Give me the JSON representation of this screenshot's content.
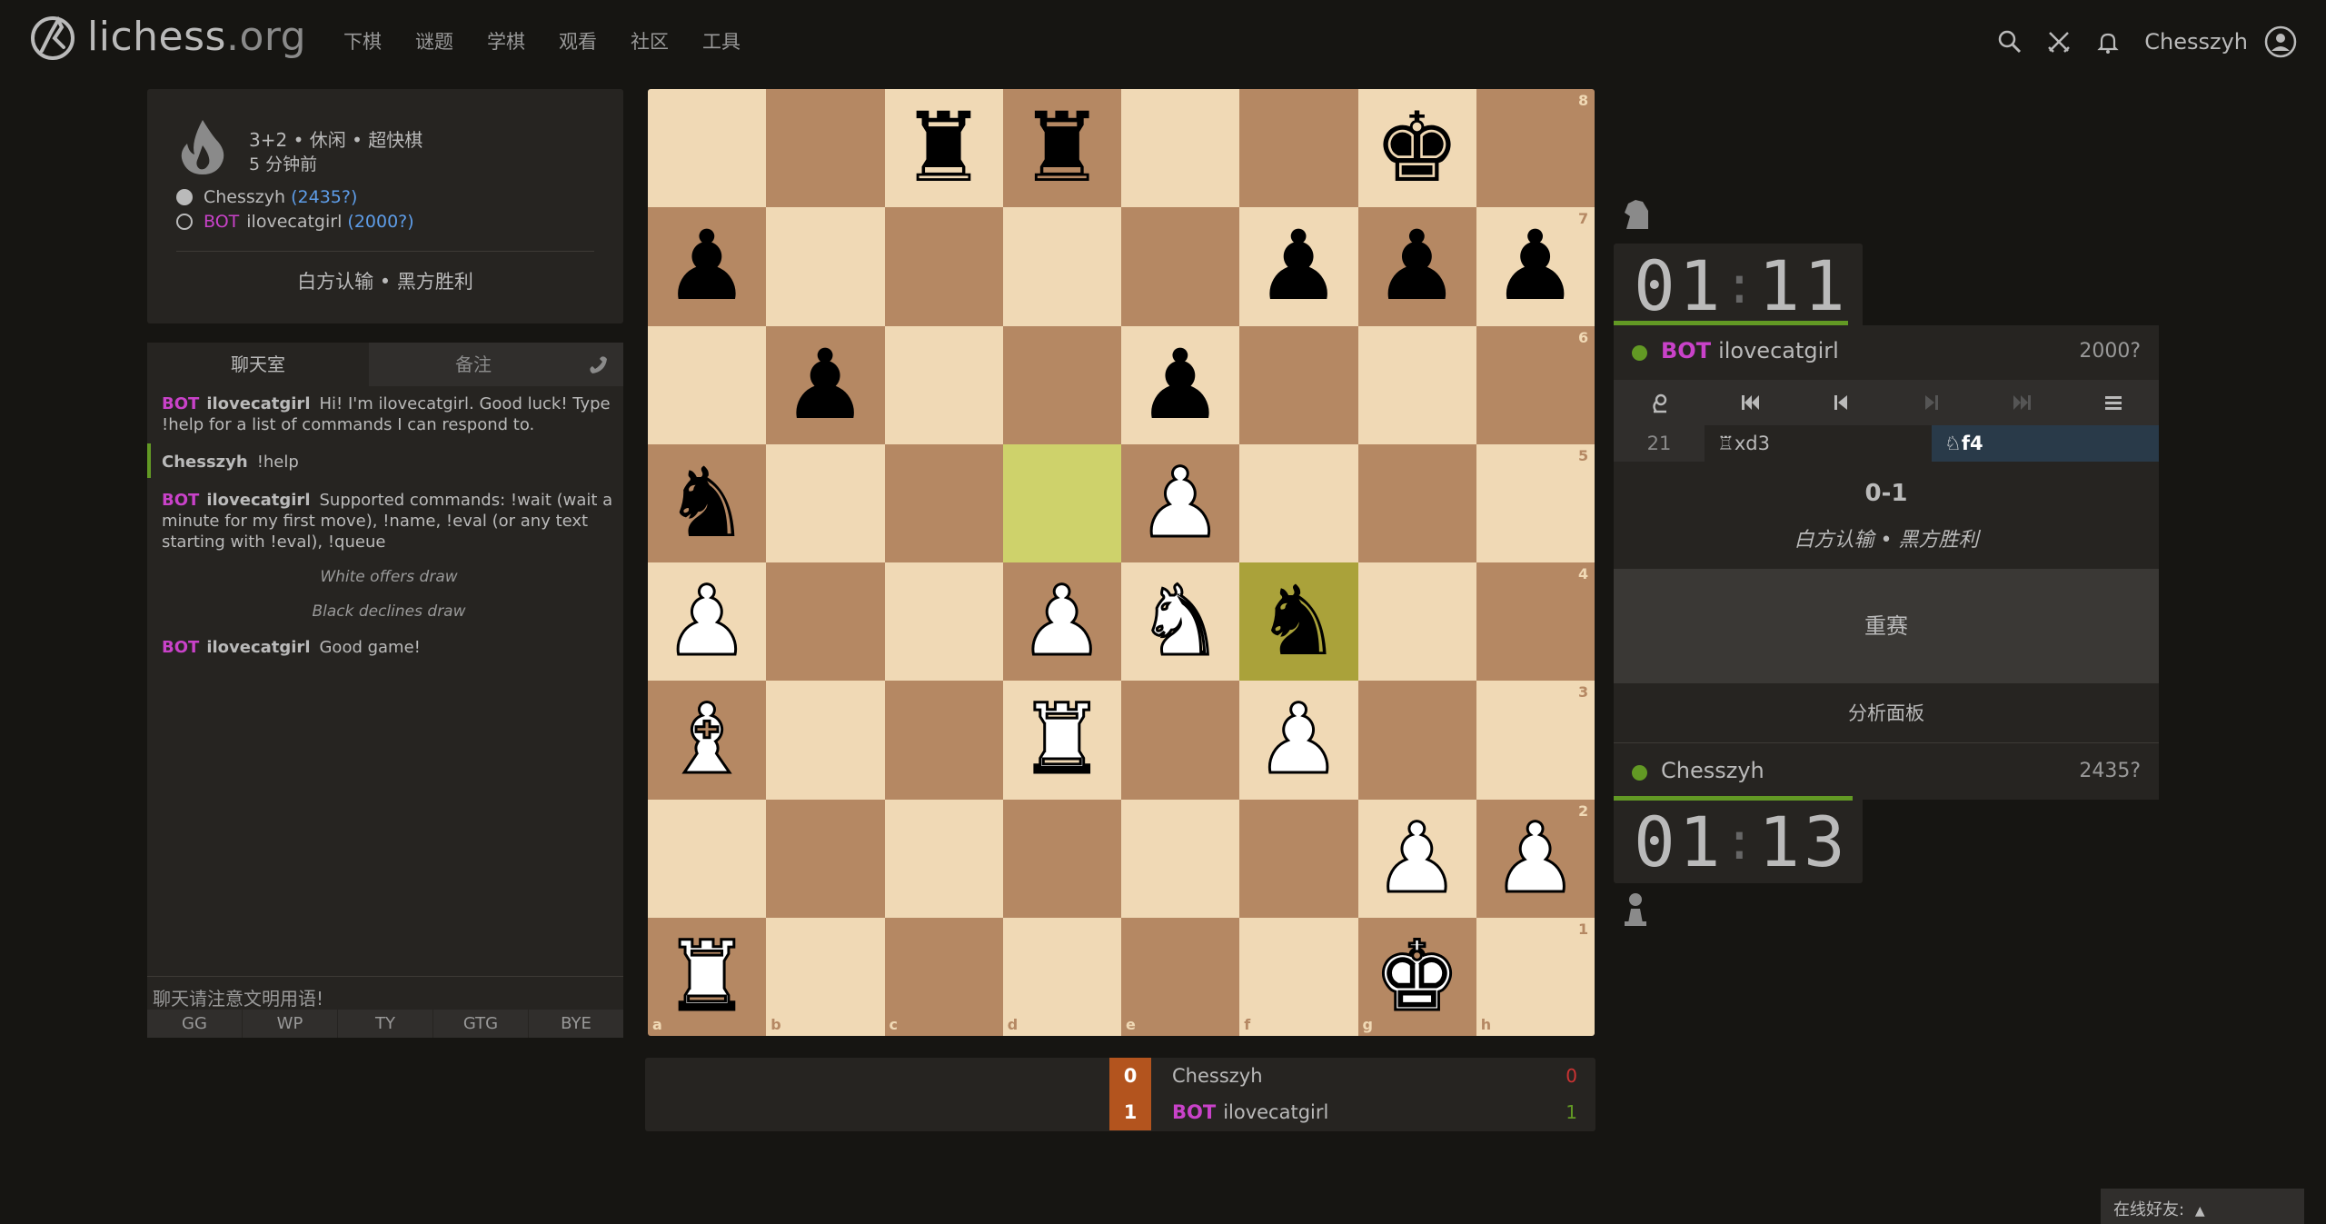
{
  "header": {
    "logo_main": "lichess",
    "logo_tld": ".org",
    "nav": [
      "下棋",
      "谜题",
      "学棋",
      "观看",
      "社区",
      "工具"
    ],
    "username": "Chesszyh"
  },
  "game_info": {
    "mode": "3+2 • 休闲 • 超快棋",
    "time_ago": "5 分钟前",
    "white_name": "Chesszyh",
    "white_rating": "(2435?)",
    "black_bot_tag": "BOT",
    "black_name": "ilovecatgirl",
    "black_rating": "(2000?)",
    "result_text": "白方认输 • 黑方胜利"
  },
  "chat": {
    "tab_chat": "聊天室",
    "tab_notes": "备注",
    "messages": [
      {
        "bot": "BOT",
        "author": "ilovecatgirl",
        "text": "Hi! I'm ilovecatgirl. Good luck! Type !help for a list of commands I can respond to."
      },
      {
        "bot": "",
        "author": "Chesszyh",
        "text": "!help"
      },
      {
        "bot": "BOT",
        "author": "ilovecatgirl",
        "text": "Supported commands: !wait (wait a minute for my first move), !name, !eval (or any text starting with !eval), !queue"
      },
      {
        "system": "White offers draw"
      },
      {
        "system": "Black declines draw"
      },
      {
        "bot": "BOT",
        "author": "ilovecatgirl",
        "text": "Good game!"
      }
    ],
    "input_placeholder": "聊天请注意文明用语!",
    "presets": [
      "GG",
      "WP",
      "TY",
      "GTG",
      "BYE"
    ]
  },
  "board": {
    "files": [
      "a",
      "b",
      "c",
      "d",
      "e",
      "f",
      "g",
      "h"
    ],
    "ranks": [
      "8",
      "7",
      "6",
      "5",
      "4",
      "3",
      "2",
      "1"
    ],
    "last_move_squares": [
      "d5",
      "f4"
    ],
    "pieces": [
      {
        "sq": "c8",
        "g": "♜",
        "c": "b"
      },
      {
        "sq": "d8",
        "g": "♜",
        "c": "b"
      },
      {
        "sq": "g8",
        "g": "♚",
        "c": "b"
      },
      {
        "sq": "a7",
        "g": "♟",
        "c": "b"
      },
      {
        "sq": "f7",
        "g": "♟",
        "c": "b"
      },
      {
        "sq": "g7",
        "g": "♟",
        "c": "b"
      },
      {
        "sq": "h7",
        "g": "♟",
        "c": "b"
      },
      {
        "sq": "b6",
        "g": "♟",
        "c": "b"
      },
      {
        "sq": "e6",
        "g": "♟",
        "c": "b"
      },
      {
        "sq": "a5",
        "g": "♞",
        "c": "b"
      },
      {
        "sq": "e5",
        "g": "♟",
        "c": "w"
      },
      {
        "sq": "a4",
        "g": "♟",
        "c": "w"
      },
      {
        "sq": "d4",
        "g": "♟",
        "c": "w"
      },
      {
        "sq": "e4",
        "g": "♞",
        "c": "w"
      },
      {
        "sq": "f4",
        "g": "♞",
        "c": "b"
      },
      {
        "sq": "a3",
        "g": "♝",
        "c": "w"
      },
      {
        "sq": "d3",
        "g": "♜",
        "c": "w"
      },
      {
        "sq": "f3",
        "g": "♟",
        "c": "w"
      },
      {
        "sq": "g2",
        "g": "♟",
        "c": "w"
      },
      {
        "sq": "h2",
        "g": "♟",
        "c": "w"
      },
      {
        "sq": "a1",
        "g": "♜",
        "c": "w"
      },
      {
        "sq": "g1",
        "g": "♚",
        "c": "w"
      }
    ]
  },
  "scoreboard": {
    "rows": [
      {
        "num": "0",
        "bot": "",
        "name": "Chesszyh",
        "points": "0",
        "points_color": "#cc3333"
      },
      {
        "num": "1",
        "bot": "BOT",
        "name": "ilovecatgirl",
        "points": "1",
        "points_color": "#629924"
      }
    ]
  },
  "right_panel": {
    "top_clock_min": "01",
    "top_clock_sec": "11",
    "top_clock_progress": 0.94,
    "top_player_bot": "BOT",
    "top_player_name": "ilovecatgirl",
    "top_player_rating": "2000?",
    "move_number": "21",
    "move_white": "♖xd3",
    "move_black": "♘f4",
    "result_score": "0-1",
    "result_text": "白方认输 • 黑方胜利",
    "rematch": "重赛",
    "analysis": "分析面板",
    "bottom_player_name": "Chesszyh",
    "bottom_player_rating": "2435?",
    "bottom_clock_min": "01",
    "bottom_clock_sec": "13",
    "bottom_clock_progress": 0.96
  },
  "footer": {
    "friends": "在线好友:"
  }
}
